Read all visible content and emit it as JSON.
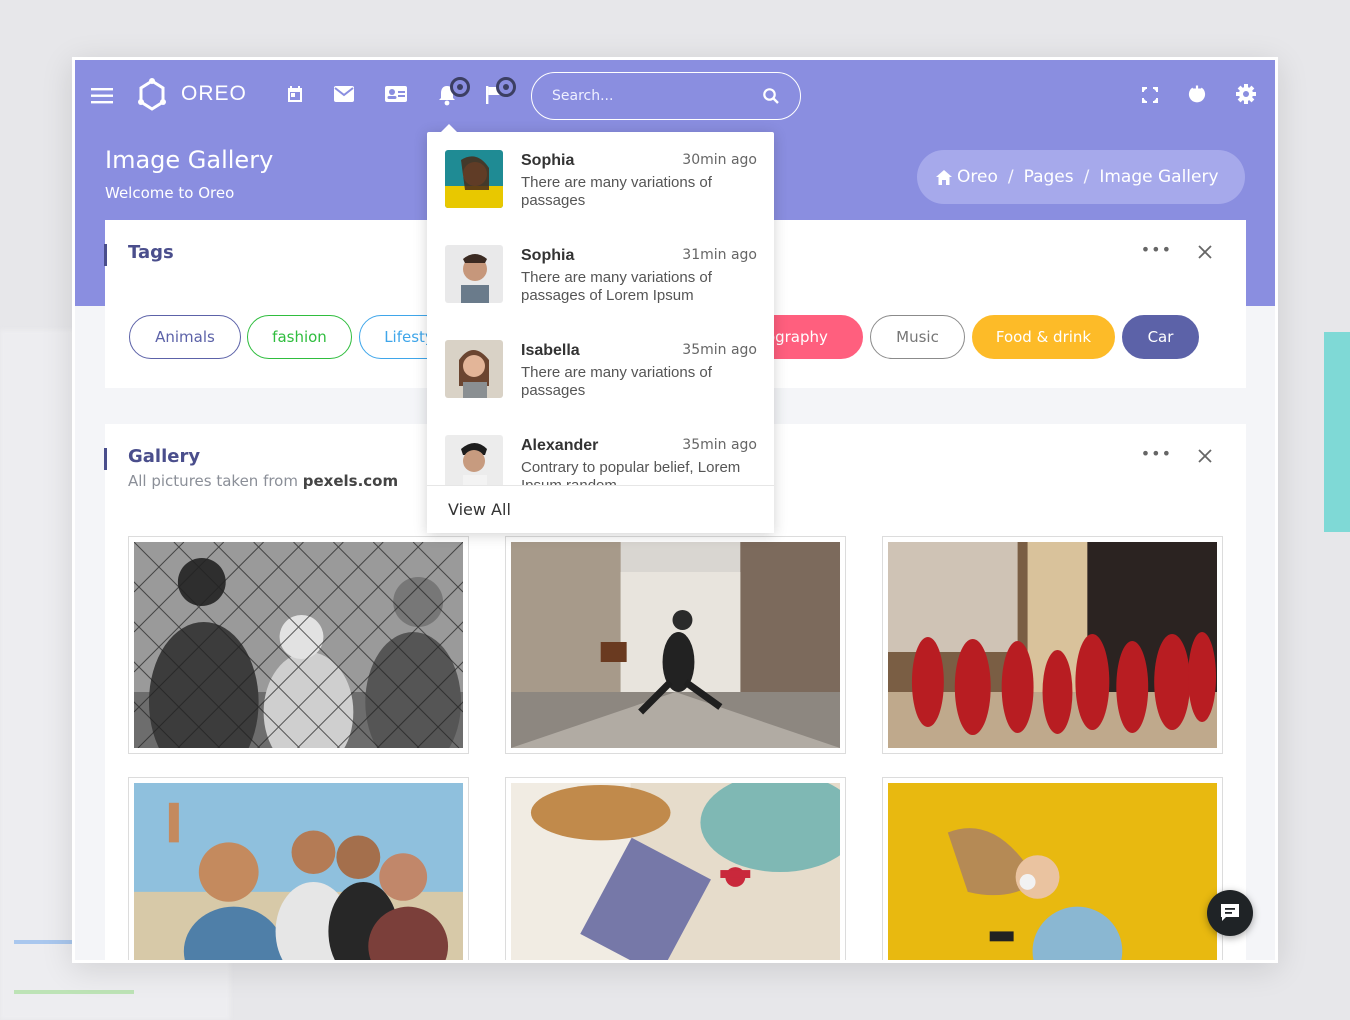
{
  "app": {
    "name": "OREO"
  },
  "search": {
    "placeholder": "Search..."
  },
  "header": {
    "title": "Image Gallery",
    "subtitle": "Welcome to Oreo"
  },
  "breadcrumb": [
    "Oreo",
    "Pages",
    "Image Gallery"
  ],
  "tags_card": {
    "title": "Tags",
    "tags": [
      {
        "label": "Animals",
        "color": "#5c62a8"
      },
      {
        "label": "fashion",
        "color": "#2fbd3e"
      },
      {
        "label": "Lifesty",
        "color": "#3fa6ea"
      },
      {
        "label": "tography",
        "color": "#ff5f7e"
      },
      {
        "label": "Music",
        "color": "#8b8b8b"
      },
      {
        "label": "Food & drink",
        "color": "#fdbb28"
      },
      {
        "label": "Car",
        "color": "#5c62a8"
      }
    ]
  },
  "gallery_card": {
    "title": "Gallery",
    "subtitle_prefix": "All pictures taken from",
    "subtitle_source": "pexels.com"
  },
  "notifications": {
    "items": [
      {
        "name": "Sophia",
        "time": "30min ago",
        "message": "There are many variations of passages"
      },
      {
        "name": "Sophia",
        "time": "31min ago",
        "message": "There are many variations of passages of Lorem Ipsum"
      },
      {
        "name": "Isabella",
        "time": "35min ago",
        "message": "There are many variations of passages"
      },
      {
        "name": "Alexander",
        "time": "35min ago",
        "message": "Contrary to popular belief, Lorem Ipsum random"
      }
    ],
    "view_all": "View All"
  },
  "colors": {
    "accent": "#8a8ee0",
    "title": "#4a4e8c"
  },
  "icons": [
    "menu-icon",
    "logo-icon",
    "calendar-icon",
    "mail-icon",
    "contact-card-icon",
    "bell-icon",
    "flag-icon",
    "search-icon",
    "fullscreen-icon",
    "power-icon",
    "settings-icon",
    "home-icon",
    "more-icon",
    "close-icon",
    "chat-icon"
  ]
}
